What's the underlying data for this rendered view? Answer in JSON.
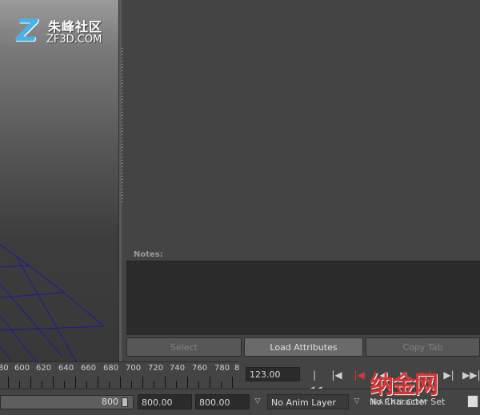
{
  "watermark": {
    "logo_cn": "朱峰社区",
    "logo_en": "ZF3D.COM",
    "corner_cn": "纳金网",
    "corner_en": "NARKII.COM"
  },
  "attribute_editor": {
    "notes_label": "Notes:",
    "buttons": {
      "select": "Select",
      "load_attributes": "Load Attributes",
      "copy_tab": "Copy Tab"
    }
  },
  "time_slider": {
    "tick_labels": [
      "80",
      "600",
      "620",
      "640",
      "660",
      "680",
      "700",
      "720",
      "740",
      "760",
      "780",
      "8"
    ],
    "current_time": "123.00"
  },
  "range_slider": {
    "range_end_label": "800",
    "start_time": "800.00",
    "end_time": "800.00",
    "anim_layer": "No Anim Layer",
    "character_set": "No Character Set"
  },
  "colors": {
    "grid_line": "#1a1a9a",
    "key_red": "#d23a3a"
  }
}
